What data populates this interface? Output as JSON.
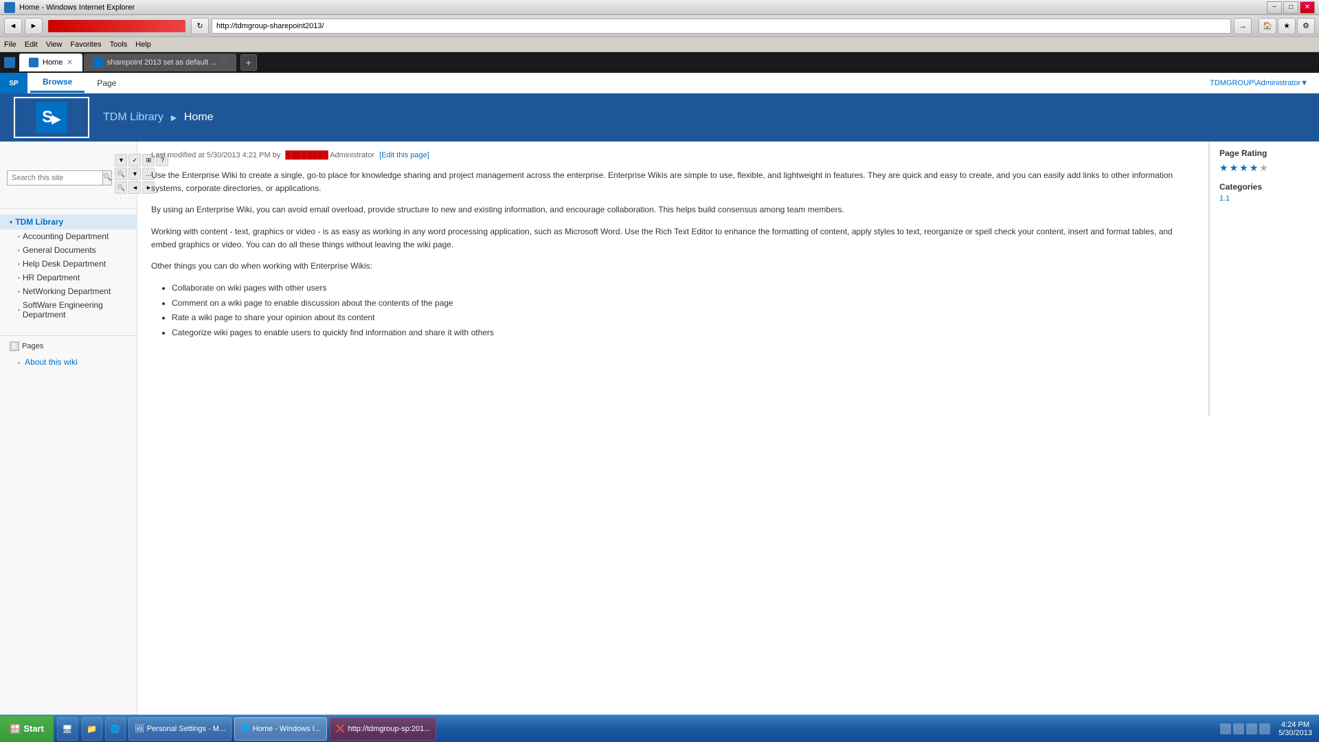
{
  "titlebar": {
    "title": "Home - Windows Internet Explorer",
    "controls": [
      "−",
      "□",
      "✕"
    ]
  },
  "addressbar": {
    "back": "◄",
    "forward": "►",
    "refresh": "↻",
    "address": "http://tdmgroup-sharepoint2013/",
    "go": "→"
  },
  "menubar": {
    "items": [
      "File",
      "Edit",
      "View",
      "Favorites",
      "Tools",
      "Help"
    ]
  },
  "tabs": [
    {
      "label": "Home",
      "active": true
    },
    {
      "label": "sharepoint 2013 set as default ...",
      "active": false
    }
  ],
  "ribbon": {
    "tabs": [
      "Browse",
      "Page"
    ],
    "active": "Browse",
    "user": "TDMGROUP\\Administrator▼"
  },
  "header": {
    "site_title": "TDM Library",
    "breadcrumb_link": "TDM Library",
    "breadcrumb_sep": "►",
    "breadcrumb_current": "Home",
    "logo_letter": "S"
  },
  "search": {
    "placeholder": "Search this site",
    "icon": "🔍"
  },
  "nav": {
    "top_item": "TDM Library",
    "sub_items": [
      "Accounting Department",
      "General Documents",
      "Help Desk Department",
      "HR Department",
      "NetWorking Department",
      "SoftWare Engineering Department"
    ],
    "pages_section": "Pages",
    "pages_items": [
      "About this wiki"
    ]
  },
  "content": {
    "last_modified": "Last modified at 5/30/2013 4:21 PM by",
    "modified_by": "Administrator",
    "edit_link": "[Edit this page]",
    "paragraphs": [
      "Use the Enterprise Wiki to create a single, go-to place for knowledge sharing and project management across the enterprise. Enterprise Wikis are simple to use, flexible, and lightweight in features. They are quick and easy to create, and you can easily add links to other information systems, corporate directories, or applications.",
      "By using an Enterprise Wiki, you can avoid email overload, provide structure to new and existing information, and encourage collaboration. This helps build consensus among team members.",
      "Working with content - text, graphics or video - is as easy as working in any word processing application, such as Microsoft Word. Use the Rich Text Editor to enhance the formatting of content, apply styles to text, reorganize or spell check your content, insert and format tables, and embed graphics or video. You can do all these things without leaving the wiki page.",
      "Other things you can do when working with Enterprise Wikis:"
    ],
    "list_items": [
      "Collaborate on wiki pages with other users",
      "Comment on a wiki page to enable discussion about the contents of the page",
      "Rate a wiki page to share your opinion about its content",
      "Categorize wiki pages to enable users to quickly find information and share it with others"
    ]
  },
  "sidebar": {
    "page_rating_label": "Page Rating",
    "stars": 4.5,
    "categories_label": "Categories",
    "categories_value": "1.1"
  },
  "taskbar": {
    "start_label": "Start",
    "buttons": [
      {
        "label": "Personal Settings - M...",
        "active": false
      },
      {
        "label": "Home - Windows I...",
        "active": true
      },
      {
        "label": "http://tdmgroup-sp:201...",
        "active": false
      }
    ],
    "time": "4:24 PM",
    "date": "5/30/2013"
  }
}
